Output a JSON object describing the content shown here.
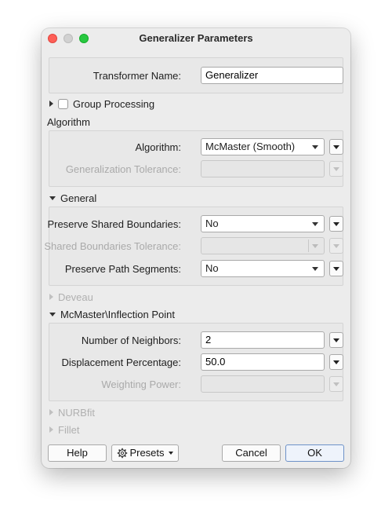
{
  "window": {
    "title": "Generalizer Parameters"
  },
  "transformer_name": {
    "label": "Transformer Name:",
    "value": "Generalizer"
  },
  "group_processing": {
    "label": "Group Processing",
    "checked": false
  },
  "algorithm_section": {
    "heading": "Algorithm",
    "algorithm": {
      "label": "Algorithm:",
      "value": "McMaster (Smooth)"
    },
    "generalization_tolerance": {
      "label": "Generalization Tolerance:",
      "value": ""
    }
  },
  "general_section": {
    "heading": "General",
    "preserve_shared_boundaries": {
      "label": "Preserve Shared Boundaries:",
      "value": "No"
    },
    "shared_boundaries_tolerance": {
      "label": "Shared Boundaries Tolerance:",
      "value": ""
    },
    "preserve_path_segments": {
      "label": "Preserve Path Segments:",
      "value": "No"
    }
  },
  "deveau_section": {
    "heading": "Deveau",
    "enabled": false
  },
  "mcmaster_section": {
    "heading": "McMaster\\Inflection Point",
    "number_of_neighbors": {
      "label": "Number of Neighbors:",
      "value": "2"
    },
    "displacement_percentage": {
      "label": "Displacement Percentage:",
      "value": "50.0"
    },
    "weighting_power": {
      "label": "Weighting Power:",
      "value": ""
    }
  },
  "nurbfit_section": {
    "heading": "NURBfit",
    "enabled": false
  },
  "fillet_section": {
    "heading": "Fillet",
    "enabled": false
  },
  "buttons": {
    "help": "Help",
    "presets": "Presets",
    "cancel": "Cancel",
    "ok": "OK"
  },
  "icons": {
    "close": "close-icon",
    "minimize": "minimize-icon",
    "zoom": "zoom-icon",
    "presets": "gear-icon"
  },
  "colors": {
    "default_button_border": "#6e92c8",
    "close": "#fe5f57",
    "zoom": "#28c840"
  }
}
